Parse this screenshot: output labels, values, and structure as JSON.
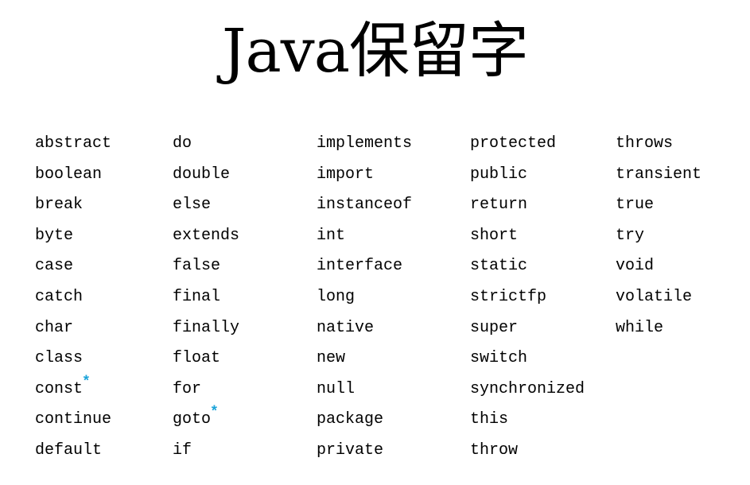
{
  "title": "Java保留字",
  "note_marker": "*",
  "marker_color": "#1aa3d9",
  "columns": [
    {
      "words": [
        {
          "text": "abstract"
        },
        {
          "text": "boolean"
        },
        {
          "text": "break"
        },
        {
          "text": "byte"
        },
        {
          "text": "case"
        },
        {
          "text": "catch"
        },
        {
          "text": "char"
        },
        {
          "text": "class"
        },
        {
          "text": "const",
          "marked": true
        },
        {
          "text": "continue"
        },
        {
          "text": "default"
        }
      ]
    },
    {
      "words": [
        {
          "text": "do"
        },
        {
          "text": "double"
        },
        {
          "text": "else"
        },
        {
          "text": "extends"
        },
        {
          "text": "false"
        },
        {
          "text": "final"
        },
        {
          "text": "finally"
        },
        {
          "text": "float"
        },
        {
          "text": "for"
        },
        {
          "text": "goto",
          "marked": true
        },
        {
          "text": "if"
        }
      ]
    },
    {
      "words": [
        {
          "text": "implements"
        },
        {
          "text": "import"
        },
        {
          "text": "instanceof"
        },
        {
          "text": "int"
        },
        {
          "text": "interface"
        },
        {
          "text": "long"
        },
        {
          "text": "native"
        },
        {
          "text": "new"
        },
        {
          "text": "null"
        },
        {
          "text": "package"
        },
        {
          "text": "private"
        }
      ]
    },
    {
      "words": [
        {
          "text": "protected"
        },
        {
          "text": "public"
        },
        {
          "text": "return"
        },
        {
          "text": "short"
        },
        {
          "text": "static"
        },
        {
          "text": "strictfp"
        },
        {
          "text": "super"
        },
        {
          "text": "switch"
        },
        {
          "text": "synchronized"
        },
        {
          "text": "this"
        },
        {
          "text": "throw"
        }
      ]
    },
    {
      "words": [
        {
          "text": "throws"
        },
        {
          "text": "transient"
        },
        {
          "text": "true"
        },
        {
          "text": "try"
        },
        {
          "text": "void"
        },
        {
          "text": "volatile"
        },
        {
          "text": "while"
        }
      ]
    }
  ]
}
